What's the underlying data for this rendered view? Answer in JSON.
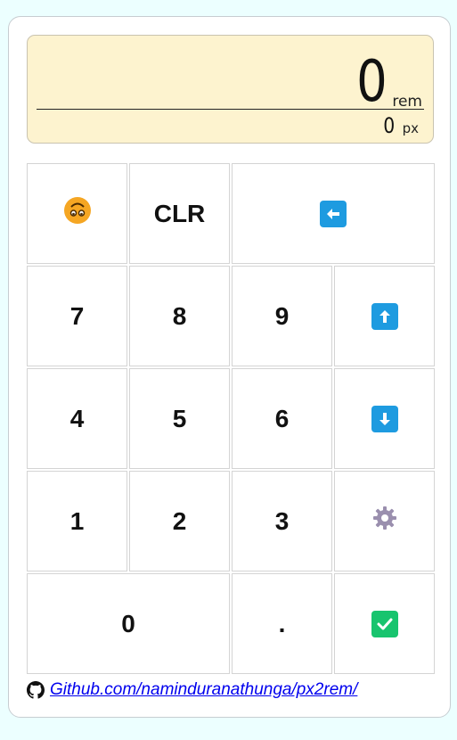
{
  "display": {
    "primary_value": "0",
    "primary_unit": "rem",
    "secondary_value": "0",
    "secondary_unit": "px"
  },
  "keys": {
    "emoji_icon": "upside-down-face-icon",
    "clear_label": "CLR",
    "backspace_icon": "left-arrow-icon",
    "seven": "7",
    "eight": "8",
    "nine": "9",
    "up_icon": "up-arrow-icon",
    "four": "4",
    "five": "5",
    "six": "6",
    "down_icon": "down-arrow-icon",
    "one": "1",
    "two": "2",
    "three": "3",
    "settings_icon": "gear-icon",
    "zero": "0",
    "decimal": ".",
    "confirm_icon": "check-mark-icon"
  },
  "footer": {
    "link_text": " Github.com/naminduranathunga/px2rem/",
    "github_icon": "github-icon"
  },
  "colors": {
    "background": "#ecffff",
    "display_bg": "#fdf3cf",
    "arrow_key": "#1e9be0",
    "confirm_key": "#18c46e",
    "gear": "#9a8fae",
    "emoji": "#f5a623",
    "link": "#0000ee"
  }
}
